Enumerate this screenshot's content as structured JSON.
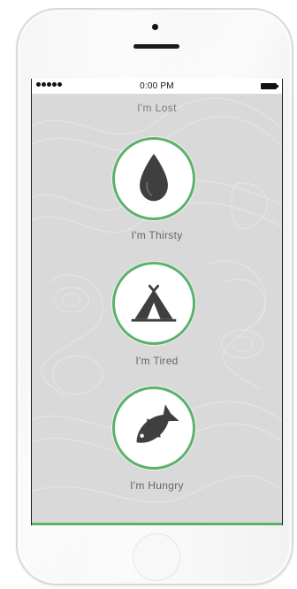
{
  "status_bar": {
    "time": "0:00 PM",
    "signal_icon": "signal-dots-icon",
    "battery_icon": "battery-icon"
  },
  "screen": {
    "title": "I'm Lost",
    "options": [
      {
        "label": "I'm Thirsty",
        "icon": "water-drop-icon"
      },
      {
        "label": "I'm Tired",
        "icon": "tent-icon"
      },
      {
        "label": "I'm Hungry",
        "icon": "fish-icon"
      }
    ]
  },
  "colors": {
    "accent": "#5cb16b",
    "icon": "#3f3f3f",
    "screen_background": "#d9d9d9",
    "label": "#666666"
  }
}
